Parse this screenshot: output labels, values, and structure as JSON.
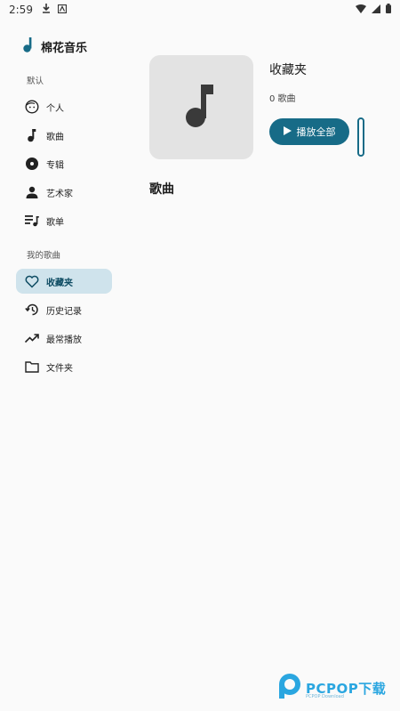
{
  "status_bar": {
    "time": "2:59"
  },
  "sidebar": {
    "app_name": "棉花音乐",
    "section_default": "默认",
    "default_items": [
      {
        "label": "个人",
        "icon": "face-icon"
      },
      {
        "label": "歌曲",
        "icon": "music-note-icon"
      },
      {
        "label": "专辑",
        "icon": "album-icon"
      },
      {
        "label": "艺术家",
        "icon": "person-icon"
      },
      {
        "label": "歌单",
        "icon": "playlist-icon"
      }
    ],
    "section_my": "我的歌曲",
    "my_items": [
      {
        "label": "收藏夹",
        "icon": "heart-icon",
        "active": true
      },
      {
        "label": "历史记录",
        "icon": "history-icon"
      },
      {
        "label": "最常播放",
        "icon": "trending-up-icon"
      },
      {
        "label": "文件夹",
        "icon": "folder-icon"
      }
    ]
  },
  "main": {
    "playlist_title": "收藏夹",
    "song_count": "0 歌曲",
    "play_all_label": "播放全部",
    "songs_heading": "歌曲"
  },
  "watermark": {
    "text": "PCPOP下载",
    "subtext": "PCPOP Download"
  },
  "colors": {
    "accent": "#176b87",
    "active_bg": "#cfe3ec",
    "background": "#fafafa"
  }
}
